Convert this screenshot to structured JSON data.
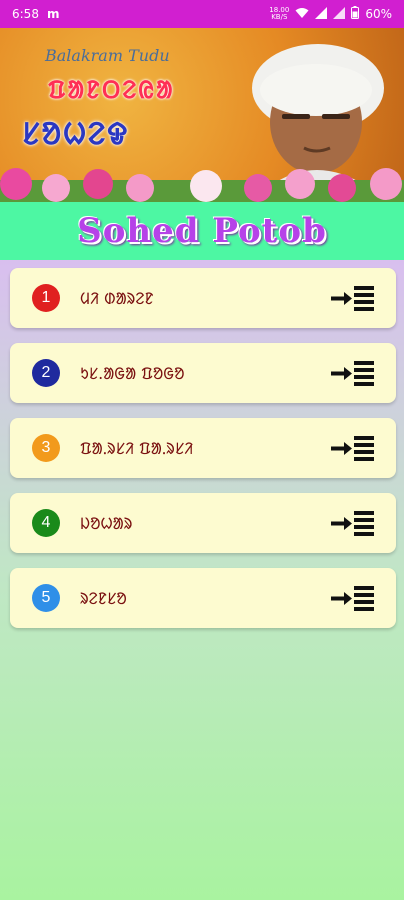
{
  "status_bar": {
    "time": "6:58",
    "app_indicator": "m",
    "net_speed_value": "18.00",
    "net_speed_unit": "KB/S",
    "battery": "60%"
  },
  "banner": {
    "author": "Balakram Tudu",
    "title_line1": "ᱯᱟᱱᱛᱮᱭᱟ",
    "title_line2": "ᱥᱚᱦᱮᱫ"
  },
  "app_title": "Sohed Potob",
  "menu": {
    "items": [
      {
        "number": "1",
        "label": "ᱢᱤ ᱰᱟᱨᱮᱱ",
        "badge_color": "#e02020"
      },
      {
        "number": "2",
        "label": "ᱩᱥ.ᱟᱜᱟ ᱯᱚᱜᱚ",
        "badge_color": "#1f2a9e"
      },
      {
        "number": "3",
        "label": "ᱯᱟᱹᱨᱥᱤ ᱯᱟᱹᱨᱥᱤ",
        "badge_color": "#f29a1c"
      },
      {
        "number": "4",
        "label": "ᱡᱚᱦᱟᱨ",
        "badge_color": "#1a8a1a"
      },
      {
        "number": "5",
        "label": "ᱨᱮᱱᱥᱚ",
        "badge_color": "#2f8fe8"
      }
    ]
  }
}
